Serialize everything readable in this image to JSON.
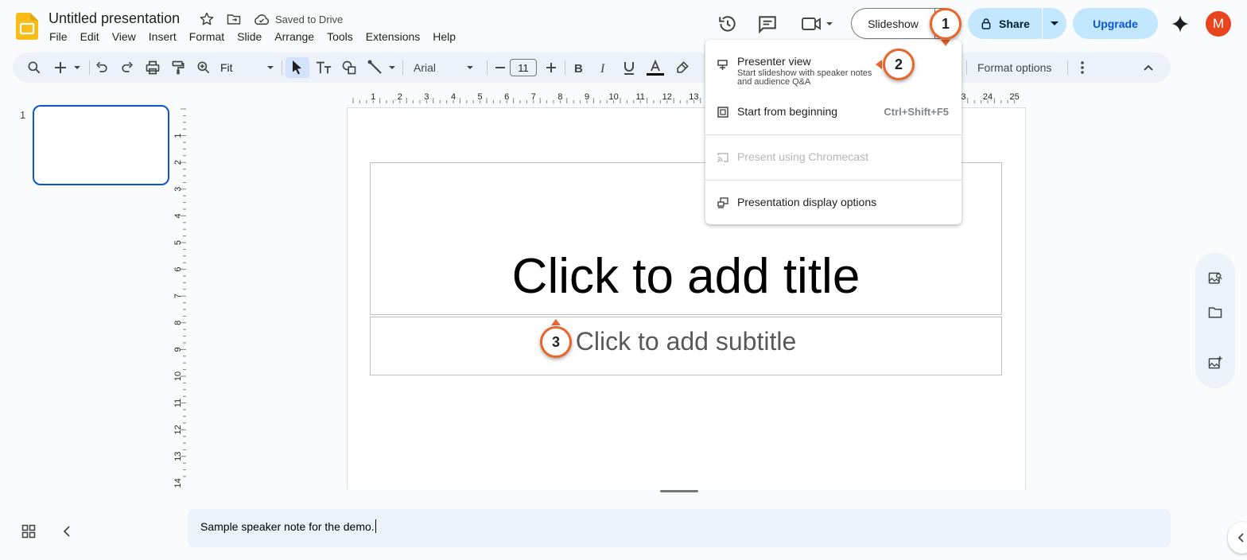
{
  "header": {
    "doc_title": "Untitled presentation",
    "saved_status": "Saved to Drive",
    "menus": [
      "File",
      "Edit",
      "View",
      "Insert",
      "Format",
      "Slide",
      "Arrange",
      "Tools",
      "Extensions",
      "Help"
    ],
    "slideshow_label": "Slideshow",
    "share_label": "Share",
    "upgrade_label": "Upgrade",
    "avatar_initial": "M"
  },
  "toolbar": {
    "zoom": "Fit",
    "font": "Arial",
    "font_size": "11",
    "format_options": "Format options"
  },
  "filmstrip": {
    "slide_number": "1"
  },
  "slide": {
    "title_placeholder": "Click to add title",
    "subtitle_placeholder": "Click to add subtitle"
  },
  "rulers": {
    "horizontal": [
      "1",
      "2",
      "3",
      "4",
      "5",
      "6",
      "7",
      "8",
      "9",
      "10",
      "11",
      "12",
      "13",
      "23",
      "24",
      "25"
    ],
    "vertical": [
      "1",
      "2",
      "3",
      "4",
      "5",
      "6",
      "7",
      "8",
      "9",
      "10",
      "11",
      "12",
      "13",
      "14"
    ]
  },
  "notes": {
    "text": "Sample speaker note for the demo."
  },
  "slideshow_menu": {
    "presenter_view": {
      "label": "Presenter view",
      "description": "Start slideshow with speaker notes and audience Q&A"
    },
    "start_from_beginning": {
      "label": "Start from beginning",
      "shortcut": "Ctrl+Shift+F5"
    },
    "chromecast": {
      "label": "Present using Chromecast"
    },
    "display_options": {
      "label": "Presentation display options"
    }
  },
  "markers": [
    "1",
    "2",
    "3"
  ],
  "colors": {
    "accent": "#0b57d0",
    "share_bg": "#c2e7ff",
    "avatar": "#e8441d",
    "marker_ring": "#e8662a"
  }
}
